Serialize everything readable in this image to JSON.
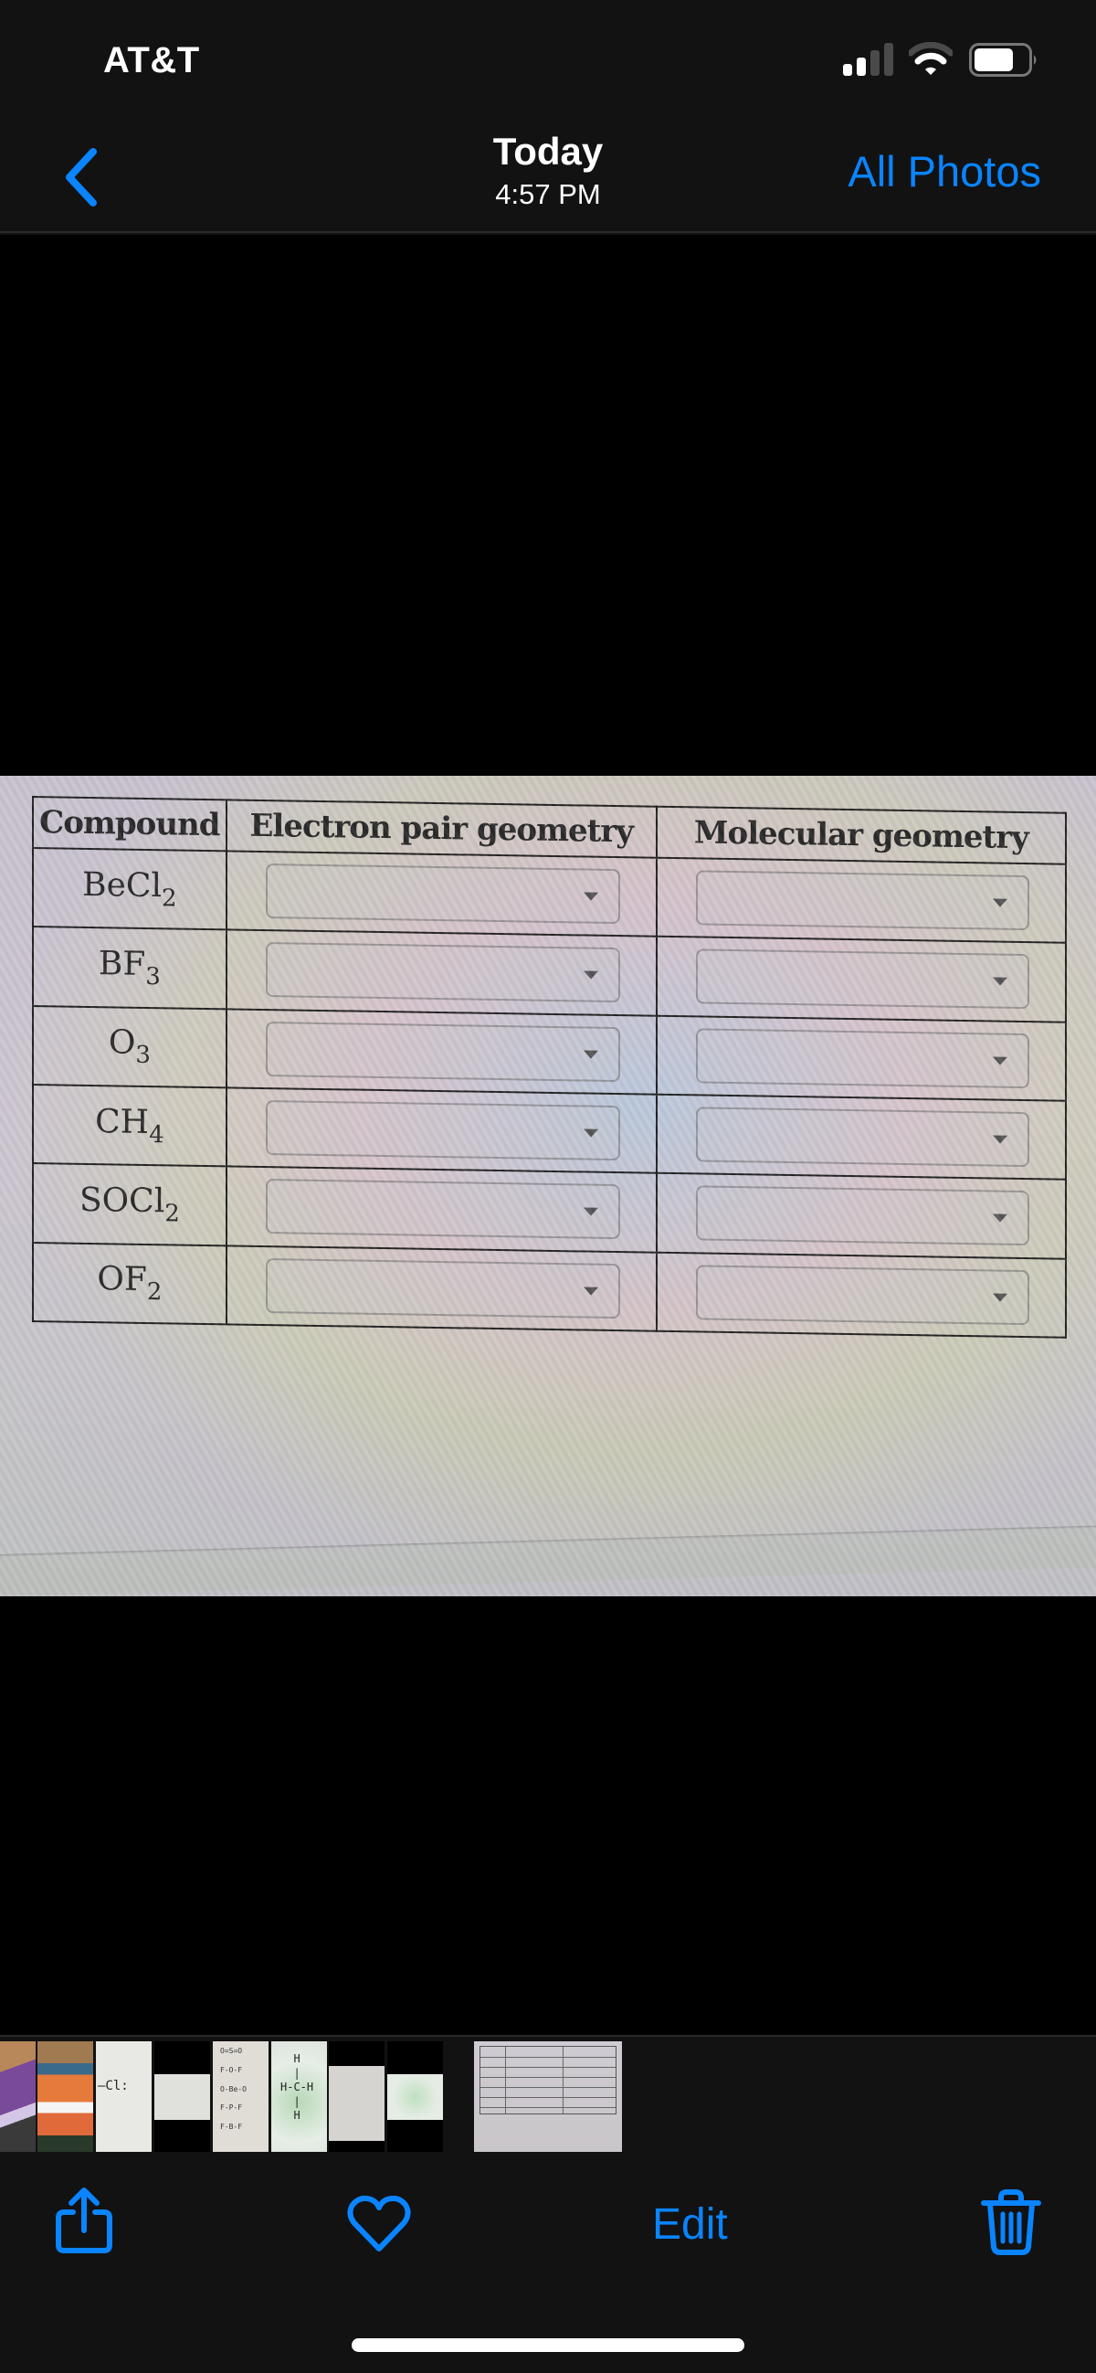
{
  "status_bar": {
    "carrier": "AT&T",
    "signal_bars_active": 2,
    "signal_bars_total": 4,
    "wifi_arcs_active": 2,
    "wifi_arcs_total": 3,
    "battery_level_percent": 65,
    "icons": [
      "signal-icon",
      "wifi-icon",
      "battery-icon"
    ]
  },
  "nav_bar": {
    "back_icon": "chevron-left-icon",
    "title": "Today",
    "subtitle": "4:57 PM",
    "right_action": "All Photos",
    "accent_color": "#0A84FF"
  },
  "photo": {
    "table": {
      "headers": [
        "Compound",
        "Electron pair geometry",
        "Molecular geometry"
      ],
      "rows": [
        {
          "formula": "BeCl",
          "subscript": "2",
          "electron_pair_geometry": "",
          "molecular_geometry": ""
        },
        {
          "formula": "BF",
          "subscript": "3",
          "electron_pair_geometry": "",
          "molecular_geometry": ""
        },
        {
          "formula": "O",
          "subscript": "3",
          "electron_pair_geometry": "",
          "molecular_geometry": ""
        },
        {
          "formula": "CH",
          "subscript": "4",
          "electron_pair_geometry": "",
          "molecular_geometry": ""
        },
        {
          "formula": "SOCl",
          "subscript": "2",
          "electron_pair_geometry": "",
          "molecular_geometry": ""
        },
        {
          "formula": "OF",
          "subscript": "2",
          "electron_pair_geometry": "",
          "molecular_geometry": ""
        }
      ],
      "dropdown_icon": "caret-down-icon"
    }
  },
  "thumbnails": {
    "count": 9,
    "selected_index": 8,
    "mini_labels": {
      "t5": "O=S=O\n\nF-O-F\n\nO-Be-O\n\nF-P-F\n\nF-B-F",
      "t6": "  H\n  |\nH-C-H\n  |\n  H"
    }
  },
  "toolbar": {
    "share_icon": "share-icon",
    "favorite_icon": "heart-icon",
    "edit_label": "Edit",
    "delete_icon": "trash-icon"
  }
}
